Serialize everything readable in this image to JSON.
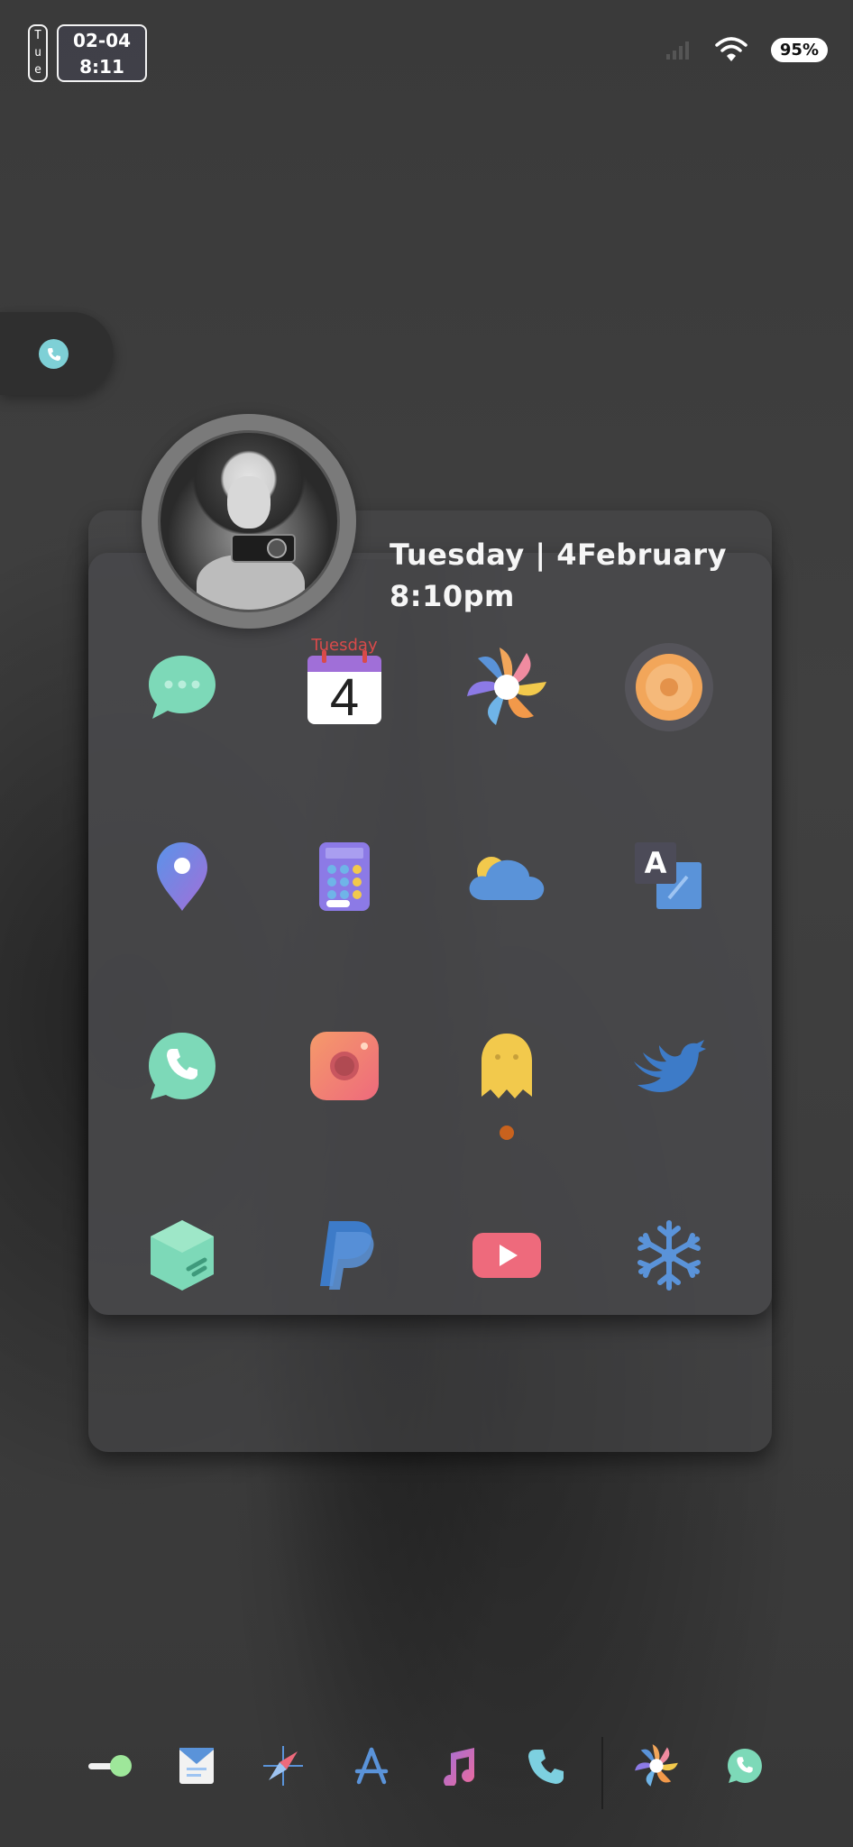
{
  "status_bar": {
    "day_letters": [
      "T",
      "u",
      "e"
    ],
    "date": "02-04",
    "time": "8:11",
    "battery": "95%",
    "icons": [
      "signal-icon",
      "wifi-icon"
    ]
  },
  "widget": {
    "date_line": "Tuesday | 4February",
    "time_line": "8:10pm"
  },
  "apps": [
    {
      "name": "messages-icon"
    },
    {
      "name": "calendar-icon",
      "month": "Tuesday",
      "day": "4"
    },
    {
      "name": "photos-icon"
    },
    {
      "name": "music-disc-icon"
    },
    {
      "name": "maps-pin-icon"
    },
    {
      "name": "calculator-icon"
    },
    {
      "name": "weather-icon"
    },
    {
      "name": "translate-icon",
      "letter": "A"
    },
    {
      "name": "whatsapp-icon"
    },
    {
      "name": "instagram-icon"
    },
    {
      "name": "ghost-app-icon"
    },
    {
      "name": "twitter-icon"
    },
    {
      "name": "hexagon-app-icon"
    },
    {
      "name": "paypal-icon",
      "letter": "P"
    },
    {
      "name": "youtube-icon"
    },
    {
      "name": "snowflake-icon"
    }
  ],
  "dock": [
    {
      "name": "toggle-icon"
    },
    {
      "name": "mail-icon"
    },
    {
      "name": "compass-icon"
    },
    {
      "name": "app-store-icon"
    },
    {
      "name": "music-note-icon"
    },
    {
      "name": "phone-icon"
    },
    {
      "name": "photos-icon"
    },
    {
      "name": "whatsapp-icon"
    }
  ],
  "colors": {
    "mint": "#7dd9b8",
    "blue": "#5a93d9",
    "accent_orange": "#c8621e"
  }
}
